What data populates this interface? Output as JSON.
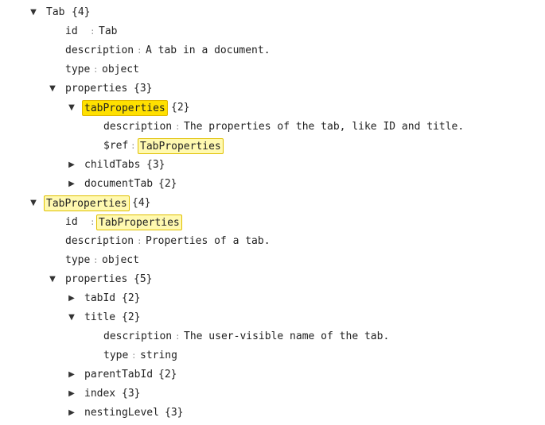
{
  "tree": {
    "tab": {
      "key": "Tab",
      "count": "{4}",
      "id_key": "id",
      "id_value": "Tab",
      "description_key": "description",
      "description_value": "A tab in a document.",
      "type_key": "type",
      "type_value": "object",
      "properties_key": "properties",
      "properties_count": "{3}",
      "tabProperties_key": "tabProperties",
      "tabProperties_count": "{2}",
      "tabProperties_description_key": "description",
      "tabProperties_description_value": "The properties of the tab, like ID and title.",
      "tabProperties_ref_key": "$ref",
      "tabProperties_ref_value": "TabProperties",
      "childTabs_key": "childTabs",
      "childTabs_count": "{3}",
      "documentTab_key": "documentTab",
      "documentTab_count": "{2}"
    },
    "tabProperties": {
      "key": "TabProperties",
      "count": "{4}",
      "id_key": "id",
      "id_value": "TabProperties",
      "description_key": "description",
      "description_value": "Properties of a tab.",
      "type_key": "type",
      "type_value": "object",
      "properties_key": "properties",
      "properties_count": "{5}",
      "tabId_key": "tabId",
      "tabId_count": "{2}",
      "title_key": "title",
      "title_count": "{2}",
      "title_description_key": "description",
      "title_description_value": "The user-visible name of the tab.",
      "title_type_key": "type",
      "title_type_value": "string",
      "parentTabId_key": "parentTabId",
      "parentTabId_count": "{2}",
      "index_key": "index",
      "index_count": "{3}",
      "nestingLevel_key": "nestingLevel",
      "nestingLevel_count": "{3}"
    },
    "separator": ":",
    "icons": {
      "expanded": "caret-down-icon",
      "collapsed": "caret-right-icon"
    },
    "colors": {
      "highlight_strong": "#ffe000",
      "highlight_soft": "#fff9b0",
      "highlight_border": "#e0c000"
    }
  }
}
